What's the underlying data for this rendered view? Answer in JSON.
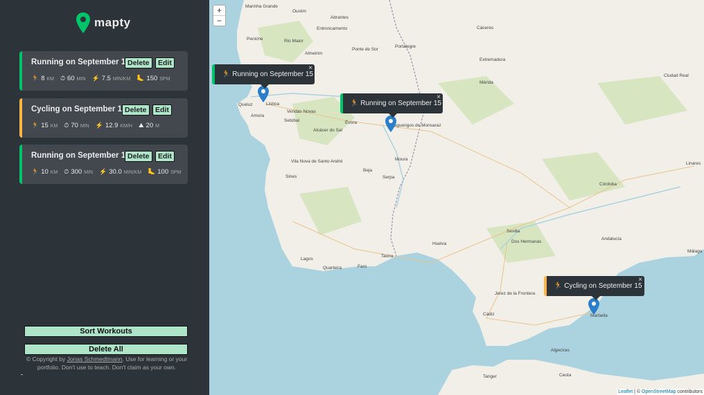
{
  "sidebar": {
    "logo_text": "mapty",
    "workouts": [
      {
        "title": "Running on September 15",
        "delete_label": "Delete",
        "edit_label": "Edit",
        "stats": [
          {
            "icon": "🏃",
            "value": "8",
            "unit": "KM"
          },
          {
            "icon": "⏱",
            "value": "60",
            "unit": "MIN"
          },
          {
            "icon": "⚡",
            "value": "7.5",
            "unit": "MIN/KM"
          },
          {
            "icon": "🦶",
            "value": "150",
            "unit": "SPM"
          }
        ]
      },
      {
        "title": "Cycling on September 15",
        "delete_label": "Delete",
        "edit_label": "Edit",
        "stats": [
          {
            "icon": "🏃",
            "value": "15",
            "unit": "KM"
          },
          {
            "icon": "⏱",
            "value": "70",
            "unit": "MIN"
          },
          {
            "icon": "⚡",
            "value": "12.9",
            "unit": "KM/H"
          },
          {
            "icon": "⛰",
            "value": "20",
            "unit": "M"
          }
        ]
      },
      {
        "title": "Running on September 15",
        "delete_label": "Delete",
        "edit_label": "Edit",
        "stats": [
          {
            "icon": "🏃",
            "value": "10",
            "unit": "KM"
          },
          {
            "icon": "⏱",
            "value": "300",
            "unit": "MIN"
          },
          {
            "icon": "⚡",
            "value": "30.0",
            "unit": "MIN/KM"
          },
          {
            "icon": "🦶",
            "value": "100",
            "unit": "SPM"
          }
        ]
      }
    ],
    "sort_label": "Sort Workouts",
    "delete_all_label": "Delete All",
    "copyright_pre": "© Copyright by",
    "copyright_link": "Jonas Schmedtmann",
    "copyright_post": ". Use for learning or your portfolio. Don't use to teach. Don't claim as your own."
  },
  "map": {
    "zoom_in": "+",
    "zoom_out": "−",
    "popups": [
      {
        "icon": "🏃",
        "text": "Running on September 15",
        "close": "×"
      },
      {
        "icon": "🏃",
        "text": "Running on September 15",
        "close": "×"
      },
      {
        "icon": "🏃",
        "text": "Cycling on September 15",
        "close": "×"
      }
    ],
    "attribution_leaflet": "Leaflet",
    "attribution_sep": " | © ",
    "attribution_osm": "OpenStreetMap",
    "attribution_post": " contributors",
    "places": [
      "Marinha Grande",
      "Ourém",
      "Abrantes",
      "Peniche",
      "Entroncamento",
      "Rio Maior",
      "Ponte de Sor",
      "Portalegre",
      "Cáceres",
      "Almeirim",
      "Extremadura",
      "Mérida",
      "Ciudad Real",
      "Lisboa",
      "Queluz",
      "Amora",
      "Setúbal",
      "Vendas Novas",
      "Évora",
      "Reguengos de Monsaraz",
      "Alcácer do Sal",
      "Vila Nova de Santo André",
      "Beja",
      "Sines",
      "Moura",
      "Serpa",
      "Linares",
      "Córdoba",
      "Lagos",
      "Quarteira",
      "Faro",
      "Tavira",
      "Huelva",
      "Sevilla",
      "Dos Hermanas",
      "Andalucía",
      "Jerez de la Frontera",
      "Cádiz",
      "Marbella",
      "Algeciras",
      "Ceuta",
      "Tanger",
      "Málaga"
    ],
    "accent_running": "#00c46a",
    "accent_cycling": "#ffb545"
  }
}
